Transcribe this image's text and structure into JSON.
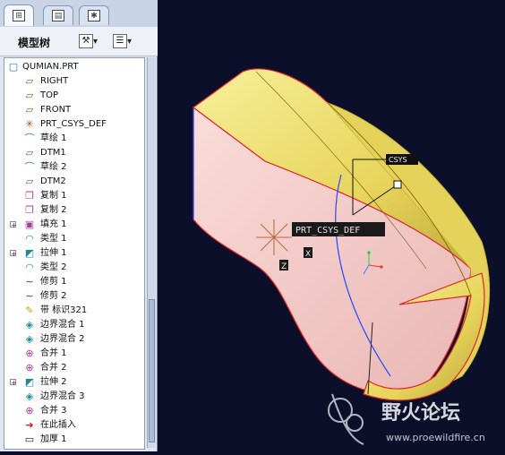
{
  "tabs": [
    {
      "name": "model-tree-tab",
      "glyph": "⊞",
      "active": true
    },
    {
      "name": "layers-tab",
      "glyph": "▤",
      "active": false
    },
    {
      "name": "favorites-tab",
      "glyph": "✱",
      "active": false
    }
  ],
  "toolbar": {
    "title": "模型树"
  },
  "tree": {
    "root": "QUMIAN.PRT",
    "items": [
      {
        "label": "RIGHT",
        "icon": "plane-icon",
        "glyph": "▱",
        "color": "#8a5a1e",
        "expander": ""
      },
      {
        "label": "TOP",
        "icon": "plane-icon",
        "glyph": "▱",
        "color": "#8a5a1e",
        "expander": ""
      },
      {
        "label": "FRONT",
        "icon": "plane-icon",
        "glyph": "▱",
        "color": "#8a5a1e",
        "expander": ""
      },
      {
        "label": "PRT_CSYS_DEF",
        "icon": "csys-icon",
        "glyph": "✳",
        "color": "#a0521e",
        "expander": ""
      },
      {
        "label": "草绘 1",
        "icon": "sketch-icon",
        "glyph": "⌒",
        "color": "#2b6cb0",
        "expander": ""
      },
      {
        "label": "DTM1",
        "icon": "plane-icon",
        "glyph": "▱",
        "color": "#8a5a1e",
        "expander": ""
      },
      {
        "label": "草绘 2",
        "icon": "sketch-icon",
        "glyph": "⌒",
        "color": "#2b6cb0",
        "expander": ""
      },
      {
        "label": "DTM2",
        "icon": "plane-icon",
        "glyph": "▱",
        "color": "#8a5a1e",
        "expander": ""
      },
      {
        "label": "复制 1",
        "icon": "copy-icon",
        "glyph": "❐",
        "color": "#a23e9a",
        "expander": ""
      },
      {
        "label": "复制 2",
        "icon": "copy-icon",
        "glyph": "❐",
        "color": "#a23e9a",
        "expander": ""
      },
      {
        "label": "填充 1",
        "icon": "fill-icon",
        "glyph": "▣",
        "color": "#a23e9a",
        "expander": "+"
      },
      {
        "label": "类型 1",
        "icon": "surface-type-icon",
        "glyph": "◠",
        "color": "#1e8aa0",
        "expander": ""
      },
      {
        "label": "拉伸 1",
        "icon": "extrude-icon",
        "glyph": "◩",
        "color": "#1e8aa0",
        "expander": "+"
      },
      {
        "label": "类型 2",
        "icon": "surface-type-icon",
        "glyph": "◠",
        "color": "#1e8aa0",
        "expander": ""
      },
      {
        "label": "修剪 1",
        "icon": "trim-icon",
        "glyph": "∼",
        "color": "#6b2a2a",
        "expander": ""
      },
      {
        "label": "修剪 2",
        "icon": "trim-icon",
        "glyph": "∼",
        "color": "#6b2a2a",
        "expander": ""
      },
      {
        "label": "带 标识321",
        "icon": "ribbon-icon",
        "glyph": "✎",
        "color": "#c9a400",
        "expander": ""
      },
      {
        "label": "边界混合 1",
        "icon": "boundary-blend-icon",
        "glyph": "◈",
        "color": "#1e8aa0",
        "expander": ""
      },
      {
        "label": "边界混合 2",
        "icon": "boundary-blend-icon",
        "glyph": "◈",
        "color": "#1e8aa0",
        "expander": ""
      },
      {
        "label": "合并 1",
        "icon": "merge-icon",
        "glyph": "⊕",
        "color": "#a23e9a",
        "expander": ""
      },
      {
        "label": "合并 2",
        "icon": "merge-icon",
        "glyph": "⊕",
        "color": "#a23e9a",
        "expander": ""
      },
      {
        "label": "拉伸 2",
        "icon": "extrude-icon",
        "glyph": "◩",
        "color": "#1e8aa0",
        "expander": "+"
      },
      {
        "label": "边界混合 3",
        "icon": "boundary-blend-icon",
        "glyph": "◈",
        "color": "#1e8aa0",
        "expander": ""
      },
      {
        "label": "合并 3",
        "icon": "merge-icon",
        "glyph": "⊕",
        "color": "#a23e9a",
        "expander": ""
      },
      {
        "label": "在此插入",
        "icon": "insert-here-arrow-icon",
        "glyph": "➜",
        "color": "#c41e1e",
        "expander": ""
      },
      {
        "label": "加厚 1",
        "icon": "thicken-icon",
        "glyph": "▭",
        "color": "#222222",
        "expander": ""
      }
    ]
  },
  "viewport": {
    "csys_label": "PRT_CSYS_DEF",
    "csys_callout": "CSYS",
    "axis_x": "X",
    "axis_z": "Z",
    "watermark_title": "野火论坛",
    "watermark_url": "www.proewildfire.cn"
  },
  "colors": {
    "viewport_bg": "#0b0f29",
    "surface_pink": "#f2c7c4",
    "surface_yellow": "#e9d85c",
    "edge_red": "#e0262e",
    "curve_blue": "#2448ff"
  }
}
